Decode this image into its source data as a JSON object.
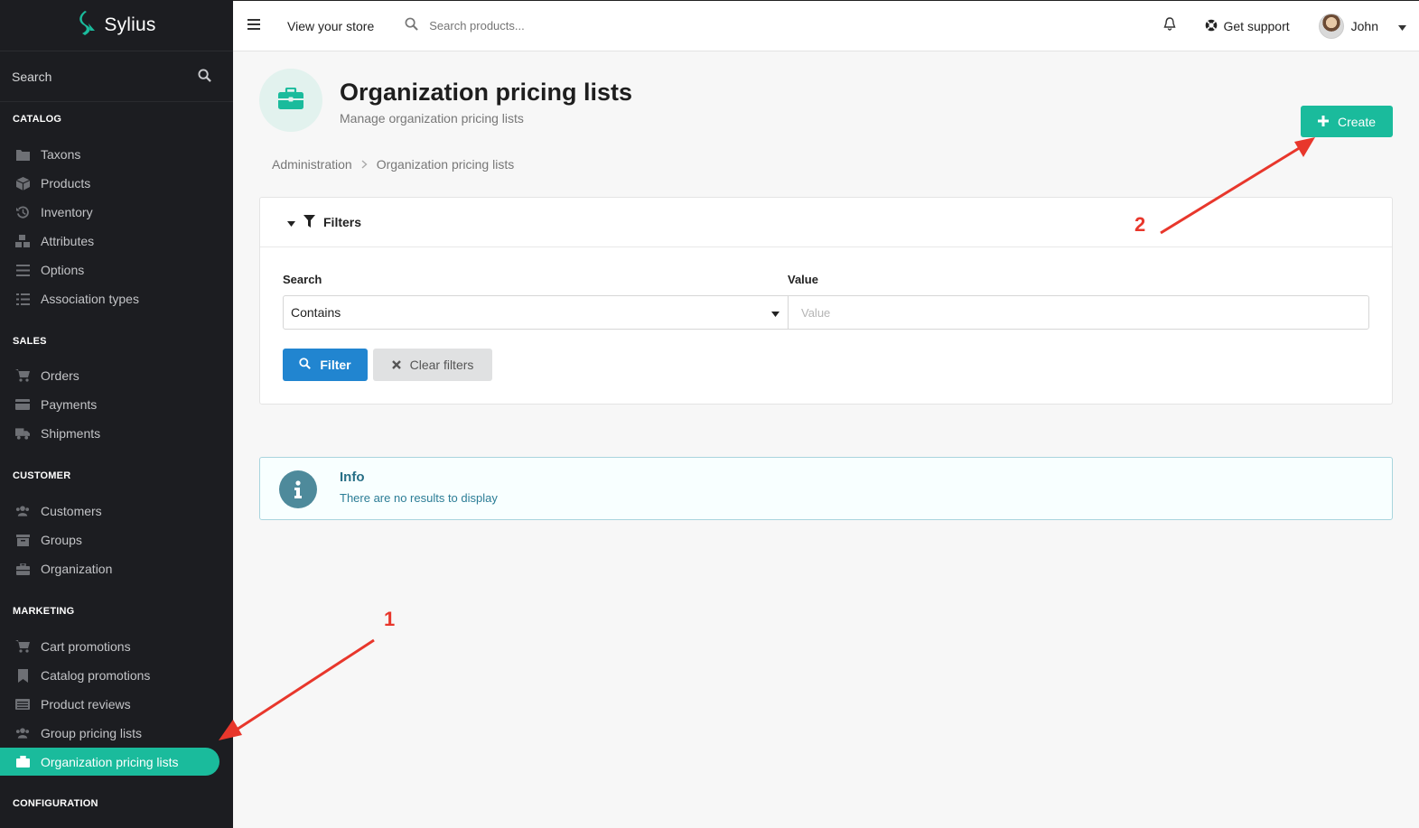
{
  "brand": {
    "name": "Sylius",
    "accent": "#1abb9c"
  },
  "sidebar": {
    "search_label": "Search",
    "sections": [
      {
        "title": "CATALOG",
        "items": [
          {
            "label": "Taxons",
            "icon": "folder-icon"
          },
          {
            "label": "Products",
            "icon": "cube-icon"
          },
          {
            "label": "Inventory",
            "icon": "history-icon"
          },
          {
            "label": "Attributes",
            "icon": "cubes-icon"
          },
          {
            "label": "Options",
            "icon": "options-icon"
          },
          {
            "label": "Association types",
            "icon": "tasks-icon"
          }
        ]
      },
      {
        "title": "SALES",
        "items": [
          {
            "label": "Orders",
            "icon": "cart-icon"
          },
          {
            "label": "Payments",
            "icon": "card-icon"
          },
          {
            "label": "Shipments",
            "icon": "truck-icon"
          }
        ]
      },
      {
        "title": "CUSTOMER",
        "items": [
          {
            "label": "Customers",
            "icon": "users-icon"
          },
          {
            "label": "Groups",
            "icon": "archive-icon"
          },
          {
            "label": "Organization",
            "icon": "briefcase-icon"
          }
        ]
      },
      {
        "title": "MARKETING",
        "items": [
          {
            "label": "Cart promotions",
            "icon": "cart-icon"
          },
          {
            "label": "Catalog promotions",
            "icon": "bookmark-icon"
          },
          {
            "label": "Product reviews",
            "icon": "newspaper-icon"
          },
          {
            "label": "Group pricing lists",
            "icon": "users-icon"
          },
          {
            "label": "Organization pricing lists",
            "icon": "briefcase-icon",
            "active": true
          }
        ]
      },
      {
        "title": "CONFIGURATION",
        "items": []
      }
    ]
  },
  "topbar": {
    "view_store": "View your store",
    "search_placeholder": "Search products...",
    "support": "Get support",
    "user": "John"
  },
  "header": {
    "title": "Organization pricing lists",
    "subtitle": "Manage organization pricing lists",
    "create_label": "Create"
  },
  "breadcrumb": {
    "root": "Administration",
    "current": "Organization pricing lists"
  },
  "filters": {
    "title": "Filters",
    "search_label": "Search",
    "value_label": "Value",
    "search_selected": "Contains",
    "value_placeholder": "Value",
    "filter_button": "Filter",
    "clear_button": "Clear filters"
  },
  "info": {
    "title": "Info",
    "message": "There are no results to display"
  },
  "annotations": {
    "one": "1",
    "two": "2",
    "color": "#e8372c"
  }
}
